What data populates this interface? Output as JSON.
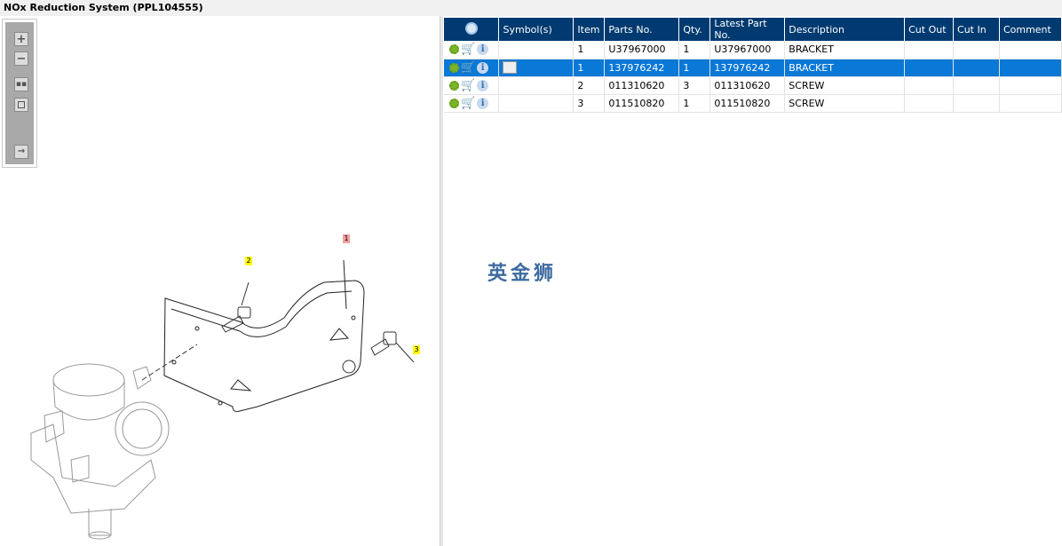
{
  "window": {
    "title": "NOx Reduction System (PPL104555)"
  },
  "toolbar": {
    "zoom_in": "+",
    "zoom_out": "−"
  },
  "drawing": {
    "callouts": [
      "1",
      "2",
      "3"
    ]
  },
  "table": {
    "columns": [
      "",
      "Symbol(s)",
      "Item",
      "Parts No.",
      "Qty.",
      "Latest Part No.",
      "Description",
      "Cut Out",
      "Cut In",
      "Comment"
    ],
    "rows": [
      {
        "item": "1",
        "parts_no": "U37967000",
        "qty": "1",
        "latest": "U37967000",
        "desc": "BRACKET",
        "cut_out": "",
        "cut_in": "",
        "comment": "",
        "selected": false,
        "symbol": false
      },
      {
        "item": "1",
        "parts_no": "137976242",
        "qty": "1",
        "latest": "137976242",
        "desc": "BRACKET",
        "cut_out": "",
        "cut_in": "",
        "comment": "",
        "selected": true,
        "symbol": true
      },
      {
        "item": "2",
        "parts_no": "011310620",
        "qty": "3",
        "latest": "011310620",
        "desc": "SCREW",
        "cut_out": "",
        "cut_in": "",
        "comment": "",
        "selected": false,
        "symbol": false
      },
      {
        "item": "3",
        "parts_no": "011510820",
        "qty": "1",
        "latest": "011510820",
        "desc": "SCREW",
        "cut_out": "",
        "cut_in": "",
        "comment": "",
        "selected": false,
        "symbol": false
      }
    ]
  },
  "watermark": "英金狮",
  "colors": {
    "header": "#003a70",
    "selected": "#0a78d7",
    "callout1": "#f4a0a0",
    "callout23": "#ffff00"
  }
}
